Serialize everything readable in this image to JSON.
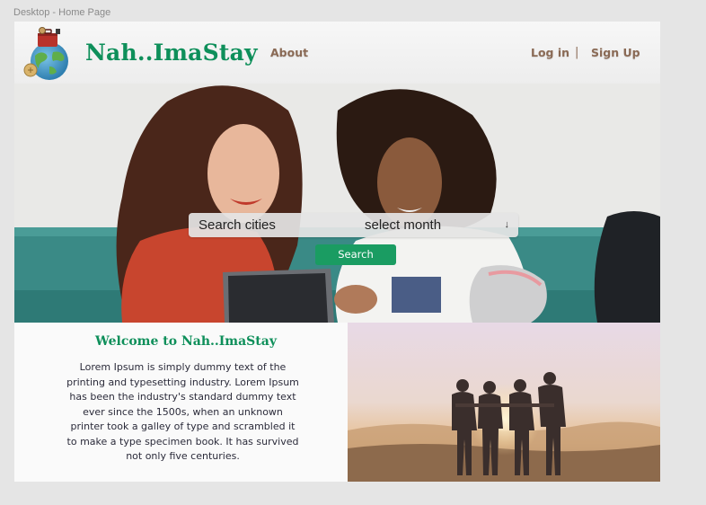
{
  "frame_label": "Desktop - Home Page",
  "header": {
    "brand": "Nah..ImaStay",
    "nav": {
      "about": "About",
      "login": "Log in",
      "separator": "|",
      "signup": "Sign Up"
    }
  },
  "search": {
    "city_placeholder": "Search cities",
    "month_label": "select month",
    "month_arrow": "↓",
    "button_label": "Search"
  },
  "welcome": {
    "title": "Welcome to Nah..ImaStay",
    "body": "Lorem Ipsum is simply dummy text of the printing and typesetting industry. Lorem Ipsum has been the industry's standard dummy text ever since the 1500s, when an unknown printer took a galley of type and scrambled it to make a type specimen book. It has survived not only five centuries."
  },
  "colors": {
    "brand_green": "#0e8f5a",
    "button_green": "#1a9c62",
    "nav_brown": "#8a6a55"
  }
}
